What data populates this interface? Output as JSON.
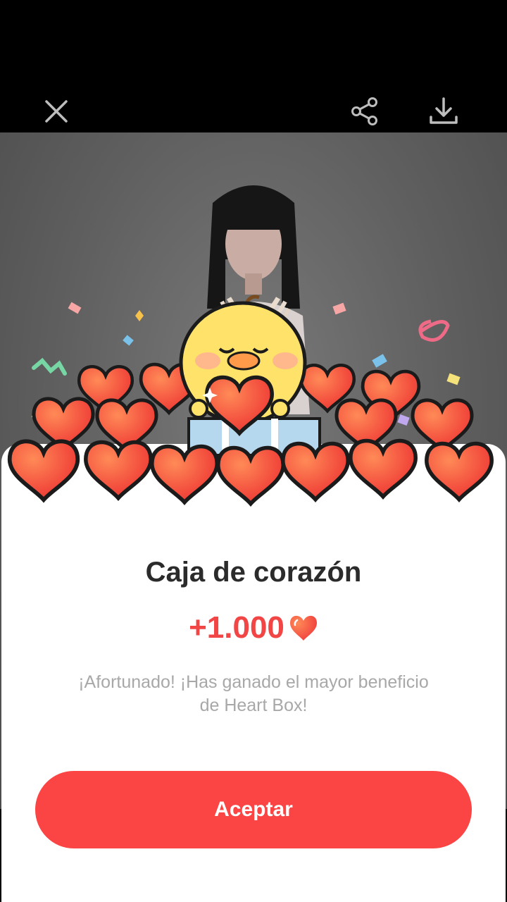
{
  "toolbar": {
    "close_icon": "close-icon",
    "share_icon": "share-icon",
    "download_icon": "download-icon"
  },
  "dialog": {
    "title": "Caja de corazón",
    "amount": "+1.000",
    "amount_icon": "heart-icon",
    "description": "¡Afortunado! ¡Has ganado el mayor beneficio de Heart Box!",
    "accept_label": "Aceptar"
  },
  "colors": {
    "accent": "#fb4444",
    "amount": "#f24545",
    "title": "#2b2b2b",
    "description": "#a8a8a8"
  }
}
